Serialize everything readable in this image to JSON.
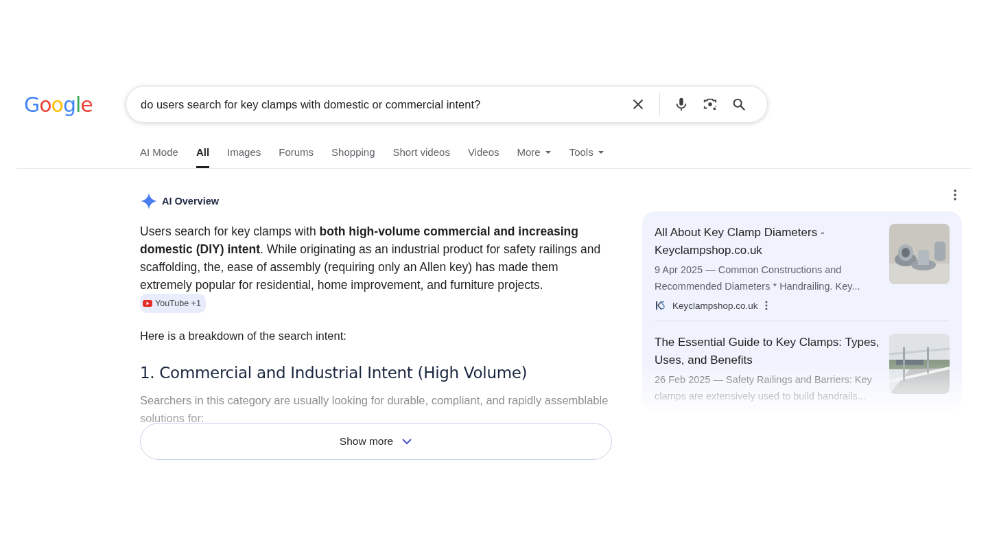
{
  "logo": "Google",
  "search": {
    "value": "do users search for key clamps with domestic or commercial intent?"
  },
  "tabs": [
    {
      "label": "AI Mode",
      "selected": false,
      "kind": "tab"
    },
    {
      "label": "All",
      "selected": true,
      "kind": "tab"
    },
    {
      "label": "Images",
      "selected": false,
      "kind": "tab"
    },
    {
      "label": "Forums",
      "selected": false,
      "kind": "tab"
    },
    {
      "label": "Shopping",
      "selected": false,
      "kind": "tab"
    },
    {
      "label": "Short videos",
      "selected": false,
      "kind": "tab"
    },
    {
      "label": "Videos",
      "selected": false,
      "kind": "tab"
    },
    {
      "label": "More",
      "selected": false,
      "kind": "menu"
    },
    {
      "label": "Tools",
      "selected": false,
      "kind": "menu"
    }
  ],
  "ai_overview": {
    "title": "AI Overview",
    "summary": "Users search for key clamps with **both high-volume commercial and increasing domestic (DIY) intent**. While originating as an industrial product for safety railings and scaffolding, the, ease of assembly (requiring only an Allen key) has made them extremely popular for residential, home improvement, and furniture projects.",
    "source_chip": "YouTube +1",
    "intro": "Here is a breakdown of the search intent:",
    "heading": "1. Commercial and Industrial Intent (High Volume)",
    "faded_text": "Searchers in this category are usually looking for durable, compliant, and rapidly assemblable solutions for:",
    "show_more": "Show more",
    "sources": [
      {
        "title": "All About Key Clamp Diameters - Keyclampshop.co.uk",
        "snippet": "9 Apr 2025 — Common Constructions and Recommended Diameters * Handrailing. Key...",
        "site": "Keyclampshop.co.uk",
        "kind": "fittings"
      },
      {
        "title": "The Essential Guide to Key Clamps: Types, Uses, and Benefits",
        "snippet": "26 Feb 2025 — Safety Railings and Barriers: Key clamps are extensively used to build handrails...",
        "kind": "railing"
      }
    ]
  }
}
